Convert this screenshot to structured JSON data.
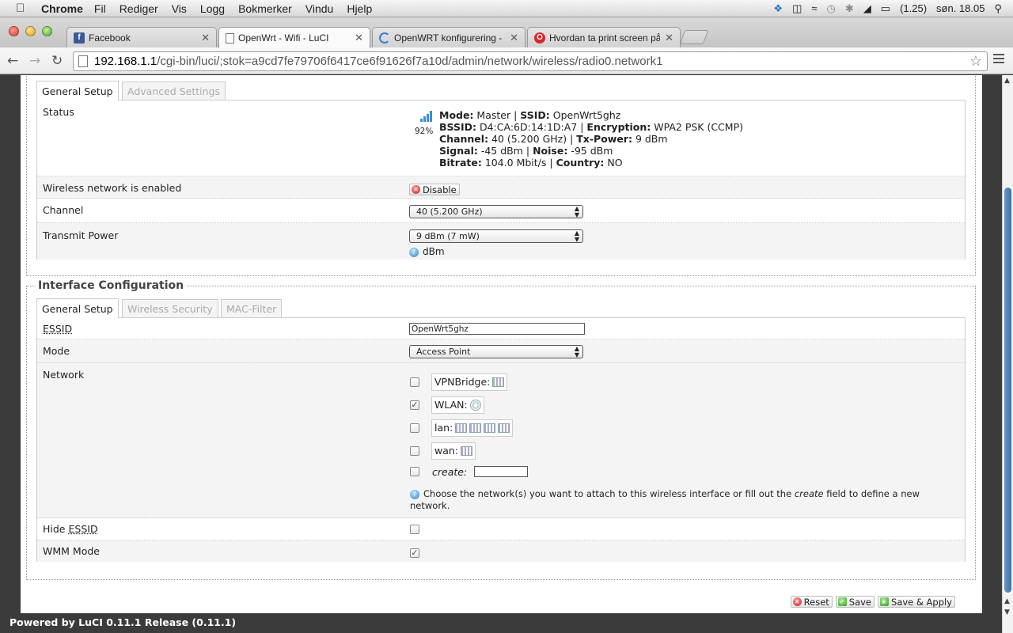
{
  "menubar": {
    "apple": "",
    "app": "Chrome",
    "items": [
      "Fil",
      "Rediger",
      "Vis",
      "Logg",
      "Bokmerker",
      "Vindu",
      "Hjelp"
    ],
    "battery": "(1.25)",
    "clock": "søn. 18.05"
  },
  "tabs": [
    {
      "label": "Facebook",
      "icon": "facebook-icon"
    },
    {
      "label": "OpenWrt - Wifi - LuCI",
      "icon": "document-icon"
    },
    {
      "label": "OpenWRT konfigurering - ",
      "icon": "loading-icon"
    },
    {
      "label": "Hvordan ta print screen på",
      "icon": "opera-icon"
    }
  ],
  "address": {
    "host": "192.168.1.1",
    "path": "/cgi-bin/luci/;stok=a9cd7fe79706f6417ce6f91626f7a10d/admin/network/wireless/radio0.network1"
  },
  "device": {
    "tabs": [
      "General Setup",
      "Advanced Settings"
    ],
    "status_label": "Status",
    "signal_pct": "92%",
    "status_lines": [
      [
        [
          "Mode:",
          " Master | "
        ],
        [
          "SSID:",
          " OpenWrt5ghz"
        ]
      ],
      [
        [
          "BSSID:",
          " D4:CA:6D:14:1D:A7 | "
        ],
        [
          "Encryption:",
          " WPA2 PSK (CCMP)"
        ]
      ],
      [
        [
          "Channel:",
          " 40 (5.200 GHz) | "
        ],
        [
          "Tx-Power:",
          " 9 dBm"
        ]
      ],
      [
        [
          "Signal:",
          " -45 dBm | "
        ],
        [
          "Noise:",
          " -95 dBm"
        ]
      ],
      [
        [
          "Bitrate:",
          " 104.0 Mbit/s | "
        ],
        [
          "Country:",
          " NO"
        ]
      ]
    ],
    "enabled_label": "Wireless network is enabled",
    "disable_button": "Disable",
    "channel_label": "Channel",
    "channel_value": "40 (5.200 GHz)",
    "txpower_label": "Transmit Power",
    "txpower_value": "9 dBm (7 mW)",
    "txpower_hint": "dBm"
  },
  "iface": {
    "legend": "Interface Configuration",
    "tabs": [
      "General Setup",
      "Wireless Security",
      "MAC-Filter"
    ],
    "essid_label": "ESSID",
    "essid_value": "OpenWrt5ghz",
    "mode_label": "Mode",
    "mode_value": "Access Point",
    "network_label": "Network",
    "networks": [
      {
        "name": "VPNBridge:",
        "checked": false
      },
      {
        "name": "WLAN:",
        "checked": true
      },
      {
        "name": "lan:",
        "checked": false
      },
      {
        "name": "wan:",
        "checked": false
      }
    ],
    "create_label": "create:",
    "network_hint_pre": "Choose the network(s) you want to attach to this wireless interface or fill out the ",
    "network_hint_em": "create",
    "network_hint_post": " field to define a new network.",
    "hide_essid_pre": "Hide ",
    "hide_essid_word": "ESSID",
    "wmm_label": "WMM Mode"
  },
  "actions": {
    "reset": "Reset",
    "save": "Save",
    "save_apply": "Save & Apply"
  },
  "footer": "Powered by LuCI 0.11.1 Release (0.11.1)"
}
